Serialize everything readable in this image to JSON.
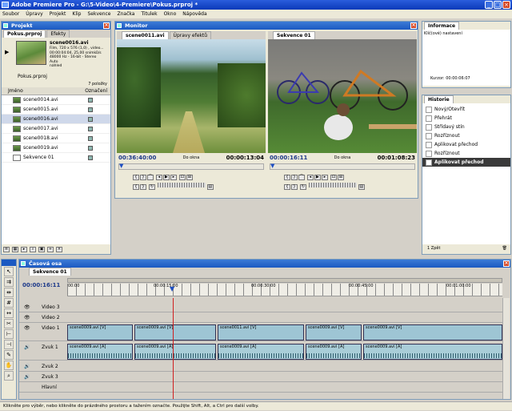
{
  "window": {
    "title": "Adobe Premiere Pro - G:\\5-Video\\4-Premiere\\Pokus.prproj *"
  },
  "menu": [
    "Soubor",
    "Úpravy",
    "Projekt",
    "Klip",
    "Sekvence",
    "Značka",
    "Titulek",
    "Okno",
    "Nápověda"
  ],
  "project": {
    "panel_title": "Projekt",
    "tabs": [
      "Pokus.prproj",
      "Efekty"
    ],
    "clip_name": "scene0016.avi",
    "clip_info": [
      "Film, 720 x 576 (1,0) , video...",
      "00:00:04:04, 25,00 snímků/s",
      "48000 Hz - 16-bit - Stereo",
      "Auto",
      "náhled"
    ],
    "bin_name": "Pokus.prproj",
    "item_count": "7 položky",
    "col_name": "Jméno",
    "col_label": "Označení",
    "files": [
      "scene0014.avi",
      "scene0015.avi",
      "scene0016.avi",
      "scene0017.avi",
      "scene0018.avi",
      "scene0019.avi",
      "Sekvence 01"
    ]
  },
  "monitor": {
    "panel_title": "Monitor",
    "source_tab": "scene0011.avi",
    "effect_tab": "Úpravy efektů",
    "seq_tab": "Sekvence 01",
    "src_tc_left": "00:36:40:00",
    "src_tc_right": "00:00:13:04",
    "fit_left": "Do okna",
    "seq_tc_left": "00:00:16:11",
    "seq_tc_right": "00:01:08:23",
    "fit_right": "Do okna"
  },
  "info": {
    "panel_title": "Informace",
    "line1": "Klíč(ové) nastavení",
    "line2_label": "Kurzor:",
    "line2_value": "00:00:06:07"
  },
  "history": {
    "panel_title": "Historie",
    "items": [
      "Nový/Otevřít",
      "Přehrát",
      "Střídavý stín",
      "Rozříznout",
      "Aplikovat přechod",
      "Rozříznout",
      "Aplikovat přechod"
    ],
    "undo_label": "1 Zpět"
  },
  "timeline": {
    "panel_title": "Časová osa",
    "seq_tab": "Sekvence 01",
    "timecode": "00:00:16:11",
    "ruler": [
      "00:00",
      "00:00:15:00",
      "00:00:30:00",
      "00:00:45:00",
      "00:01:00:00"
    ],
    "tracks": [
      "Video 3",
      "Video 2",
      "Video 1",
      "Zvuk 1",
      "Zvuk 2",
      "Zvuk 3",
      "Hlavní"
    ],
    "vclips": [
      "scene0009.avi [V]",
      "scene0009.avi [V]",
      "scene0011.avi [V]",
      "scene0009.avi [V]",
      "scene0009.avi [V]"
    ],
    "aclips": [
      "scene0009.avi [A]",
      "scene0009.avi [A]",
      "scene0009.avi [A]",
      "scene0009.avi [A]",
      "scene0009.avi [A]"
    ]
  },
  "status": "Klikněte pro výběr, nebo klikněte do prázdného prostoru a tažením označte. Použijte Shift, Alt, a Ctrl pro další volby."
}
